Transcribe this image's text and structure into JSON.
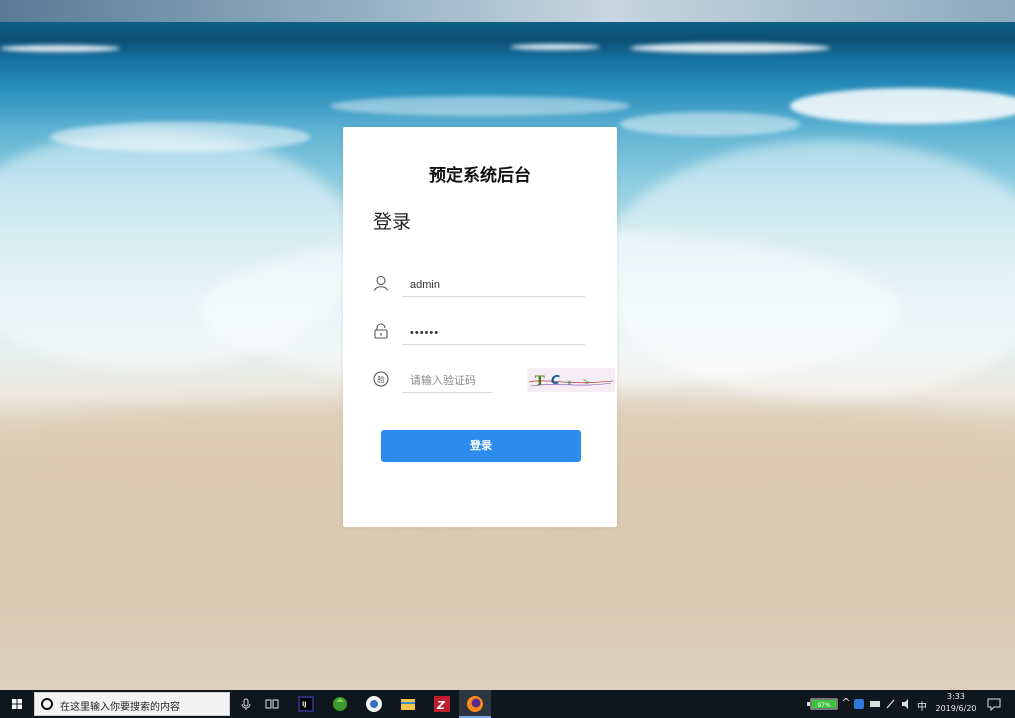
{
  "login": {
    "system_title": "预定系统后台",
    "heading": "登录",
    "username_value": "admin",
    "password_value": "••••••",
    "captcha_placeholder": "请输入验证码",
    "captcha_text": "TC",
    "submit_label": "登录"
  },
  "taskbar": {
    "search_placeholder": "在这里输入你要搜索的内容",
    "battery": "97%",
    "ime": "中",
    "time": "3:33",
    "date": "2019/6/20"
  },
  "colors": {
    "accent": "#2d8cf0",
    "taskbar": "#10161e"
  }
}
